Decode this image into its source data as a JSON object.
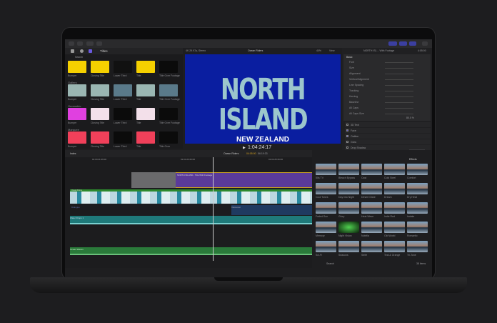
{
  "toolbar": {
    "icons": [
      "import-icon",
      "keyword-icon",
      "key-icon",
      "check-icon"
    ]
  },
  "browser": {
    "tab": "Titles",
    "search_label": "Search",
    "categories": [
      {
        "name": "",
        "items": [
          "Bumper",
          "Closing Title",
          "Lower Third",
          "Title",
          "Title Over Footage"
        ],
        "colors": [
          "#f5d000",
          "#f5d000",
          "#111111",
          "#f5d000",
          "#0b0b0b"
        ]
      },
      {
        "name": "Gallery",
        "items": [
          "Bumper",
          "Closing Title",
          "Lower Third",
          "Title",
          "Title Over Footage"
        ],
        "colors": [
          "#9ab6b2",
          "#9ab6b2",
          "#5a7a8a",
          "#9ab6b2",
          "#5a7a8a"
        ]
      },
      {
        "name": "Geometric",
        "items": [
          "Bumper",
          "Closing Title",
          "Lower Third",
          "Title",
          "Title Over Footage"
        ],
        "colors": [
          "#e040e0",
          "#f3e0ea",
          "#0b0b0b",
          "#f3e0ea",
          "#0b0b0b"
        ]
      },
      {
        "name": "Marquee",
        "items": [
          "Bumper",
          "Closing Title",
          "Lower Third",
          "Title",
          "Title Over"
        ],
        "colors": [
          "#f0405a",
          "#f0405a",
          "#0b0b0b",
          "#f0405a",
          "#0b0b0b"
        ]
      }
    ]
  },
  "viewer": {
    "format": "4K 29.97p, Stereo",
    "project": "Ocean Riders",
    "zoom": "40%",
    "view": "View",
    "title": "NORTH ISLAND",
    "subtitle": "NEW ZEALAND",
    "timecode": "1:04:24:17",
    "bg": "#0a1ea0"
  },
  "inspector": {
    "clip": "NORTH ISL... With Footage",
    "duration": "4:05:00",
    "section": "Basic",
    "rows": [
      "Font",
      "Size",
      "Alignment",
      "Vertical Alignment",
      "Line Spacing",
      "Tracking",
      "Kerning",
      "Baseline",
      "All Caps",
      "All Caps Size"
    ],
    "all_caps_size": "80.0 %",
    "toggles": [
      {
        "label": "3D Text",
        "on": false
      },
      {
        "label": "Face",
        "on": true
      },
      {
        "label": "Outline",
        "on": true
      },
      {
        "label": "Glow",
        "on": false
      },
      {
        "label": "Drop Shadow",
        "on": false
      }
    ],
    "text_layer": "Text Layer",
    "deselect": "Deselect All"
  },
  "timeline": {
    "index": "Index",
    "project": "Ocean Riders",
    "position": "04:05:00",
    "total": "56:19:33",
    "ruler": [
      "01:04:21:26:00",
      "01:04:23:26:00",
      "01:04:25:26:00"
    ],
    "clips": {
      "title": "NORTH ISLAND - Title With Footage",
      "video": "Ocean Drone",
      "dialogue": "Dialogue",
      "voiceover": "Voiceover",
      "music": "Water Drops 1",
      "sfx": "Ocean Waves"
    }
  },
  "effects": {
    "header": "Effects",
    "count": "38 items",
    "search": "Search",
    "items": [
      "50s TV",
      "Bleach Bypass",
      "Cast",
      "Cold Steel",
      "Comfort",
      "Cool Tones",
      "Day into Night",
      "Desert Glare",
      "Dream",
      "Dry Heat",
      "Faded Sun",
      "Glory",
      "Heat Wave",
      "Indie Red",
      "Isolate",
      "Memory",
      "Night Vision",
      "Nutella",
      "Old World",
      "Romantic",
      "Sci-Fi",
      "Seasons",
      "Strife",
      "Teal & Orange",
      "Tri-Tone"
    ]
  },
  "colors": {
    "accent": "#5b4bd8",
    "title_clip": "#5a3a9a",
    "video_clip": "#2e8a2e",
    "music": "#1f7a7a"
  }
}
